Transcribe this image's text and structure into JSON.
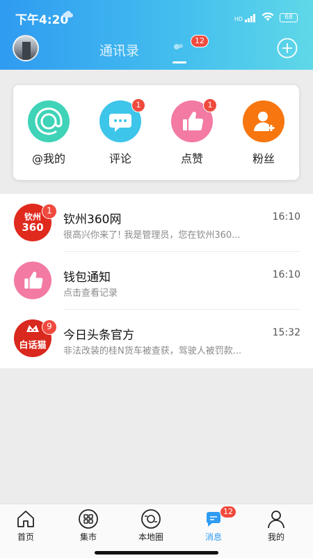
{
  "status_bar": {
    "time": "下午4:20",
    "weather_icon": "cloud-icon",
    "battery": "68",
    "signal_label": "HD"
  },
  "header": {
    "tab_contacts": "通讯录",
    "message_badge": "12",
    "add_icon": "plus-circle-icon"
  },
  "quick_actions": [
    {
      "label": "@我的",
      "icon": "at-icon",
      "color": "#3fd3b8",
      "badge": ""
    },
    {
      "label": "评论",
      "icon": "comment-bubble-icon",
      "color": "#3ec5ea",
      "badge": "1"
    },
    {
      "label": "点赞",
      "icon": "thumbs-up-icon",
      "color": "#f27aa3",
      "badge": "1"
    },
    {
      "label": "粉丝",
      "icon": "add-user-icon",
      "color": "#f7760f",
      "badge": ""
    }
  ],
  "messages": [
    {
      "title": "钦州360网",
      "preview": "很高兴你来了! 我是管理员，您在钦州360...",
      "time": "16:10",
      "badge": "1",
      "icon_text_top": "钦州",
      "icon_text_bottom": "360"
    },
    {
      "title": "钱包通知",
      "preview": "点击查看记录",
      "time": "16:10",
      "badge": ""
    },
    {
      "title": "今日头条官方",
      "preview": "非法改装的桂N货车被查获，驾驶人被罚款...",
      "time": "15:32",
      "badge": "9",
      "icon_text": "白话猫"
    }
  ],
  "tabbar": [
    {
      "label": "首页",
      "icon": "home-icon",
      "active": false
    },
    {
      "label": "集市",
      "icon": "grid-apps-icon",
      "active": false
    },
    {
      "label": "本地圈",
      "icon": "camera-circle-icon",
      "active": false
    },
    {
      "label": "消息",
      "icon": "chat-bubble-icon",
      "active": true,
      "badge": "12"
    },
    {
      "label": "我的",
      "icon": "person-icon",
      "active": false
    }
  ]
}
